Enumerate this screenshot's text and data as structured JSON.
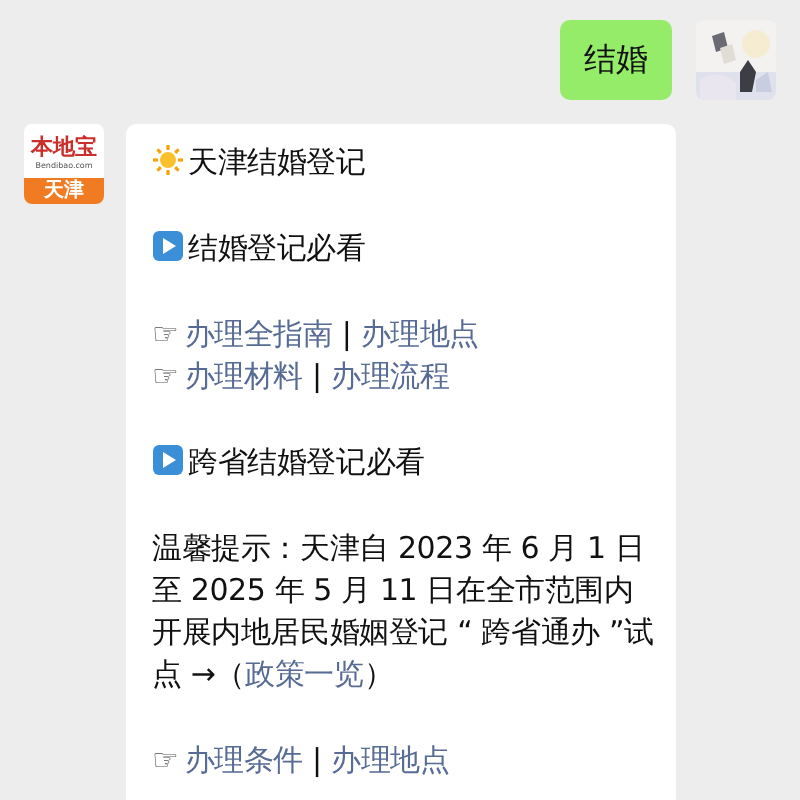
{
  "sent_message": {
    "text": "结婚"
  },
  "received_message": {
    "avatar": {
      "brand": "本地宝",
      "domain": "Bendibao.com",
      "city": "天津"
    },
    "blocks": [
      {
        "kind": "title",
        "text": "天津结婚登记"
      },
      {
        "kind": "heading",
        "text": "结婚登记必看"
      },
      {
        "kind": "link_lines",
        "lines": [
          {
            "marker": "☞",
            "separator": "|",
            "links": [
              "办理全指南",
              "办理地点"
            ]
          },
          {
            "marker": "☞",
            "separator": "|",
            "links": [
              "办理材料",
              "办理流程"
            ]
          }
        ]
      },
      {
        "kind": "heading",
        "text": "跨省结婚登记必看"
      },
      {
        "kind": "notice",
        "text": "温馨提示：天津自 2023 年 6 月 1 日至 2025 年 5 月 11 日在全市范围内开展内地居民婚姻登记 “ 跨省通办 ”试点 →（",
        "link": "政策一览",
        "after": "）"
      },
      {
        "kind": "link_lines",
        "lines": [
          {
            "marker": "☞",
            "separator": "|",
            "links": [
              "办理条件",
              "办理地点"
            ]
          }
        ]
      }
    ]
  }
}
